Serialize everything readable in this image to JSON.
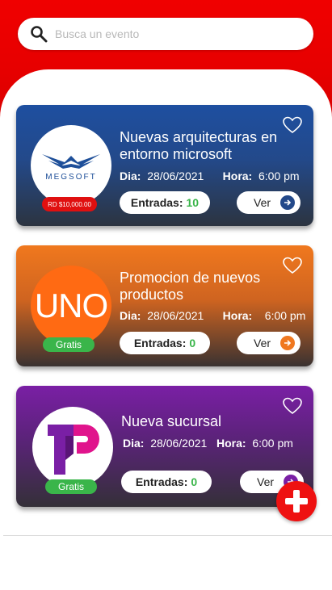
{
  "search": {
    "placeholder": "Busca un evento"
  },
  "events": [
    {
      "title": "Nuevas arquitecturas en entorno microsoft",
      "logo_text": "MEGSOFT",
      "price": "RD $10,000.00",
      "dia_label": "Dia:",
      "date": "28/06/2021",
      "hora_label": "Hora:",
      "time": "6:00 pm",
      "entradas_label": "Entradas:",
      "entradas_count": "10",
      "ver_label": "Ver",
      "accent": "#23498a"
    },
    {
      "title": "Promocion de nuevos productos",
      "logo_text": "UNO",
      "price": "Gratis",
      "dia_label": "Dia:",
      "date": "28/06/2021",
      "hora_label": "Hora:",
      "time": "6:00 pm",
      "entradas_label": "Entradas:",
      "entradas_count": "0",
      "ver_label": "Ver",
      "accent": "#f07820"
    },
    {
      "title": "Nueva sucursal",
      "price": "Gratis",
      "dia_label": "Dia:",
      "date": "28/06/2021",
      "hora_label": "Hora:",
      "time": "6:00 pm",
      "entradas_label": "Entradas:",
      "entradas_count": "0",
      "ver_label": "Ver",
      "accent": "#7a1fa5"
    }
  ],
  "colors": {
    "primary_red": "#e60000",
    "green": "#3ab54a"
  }
}
